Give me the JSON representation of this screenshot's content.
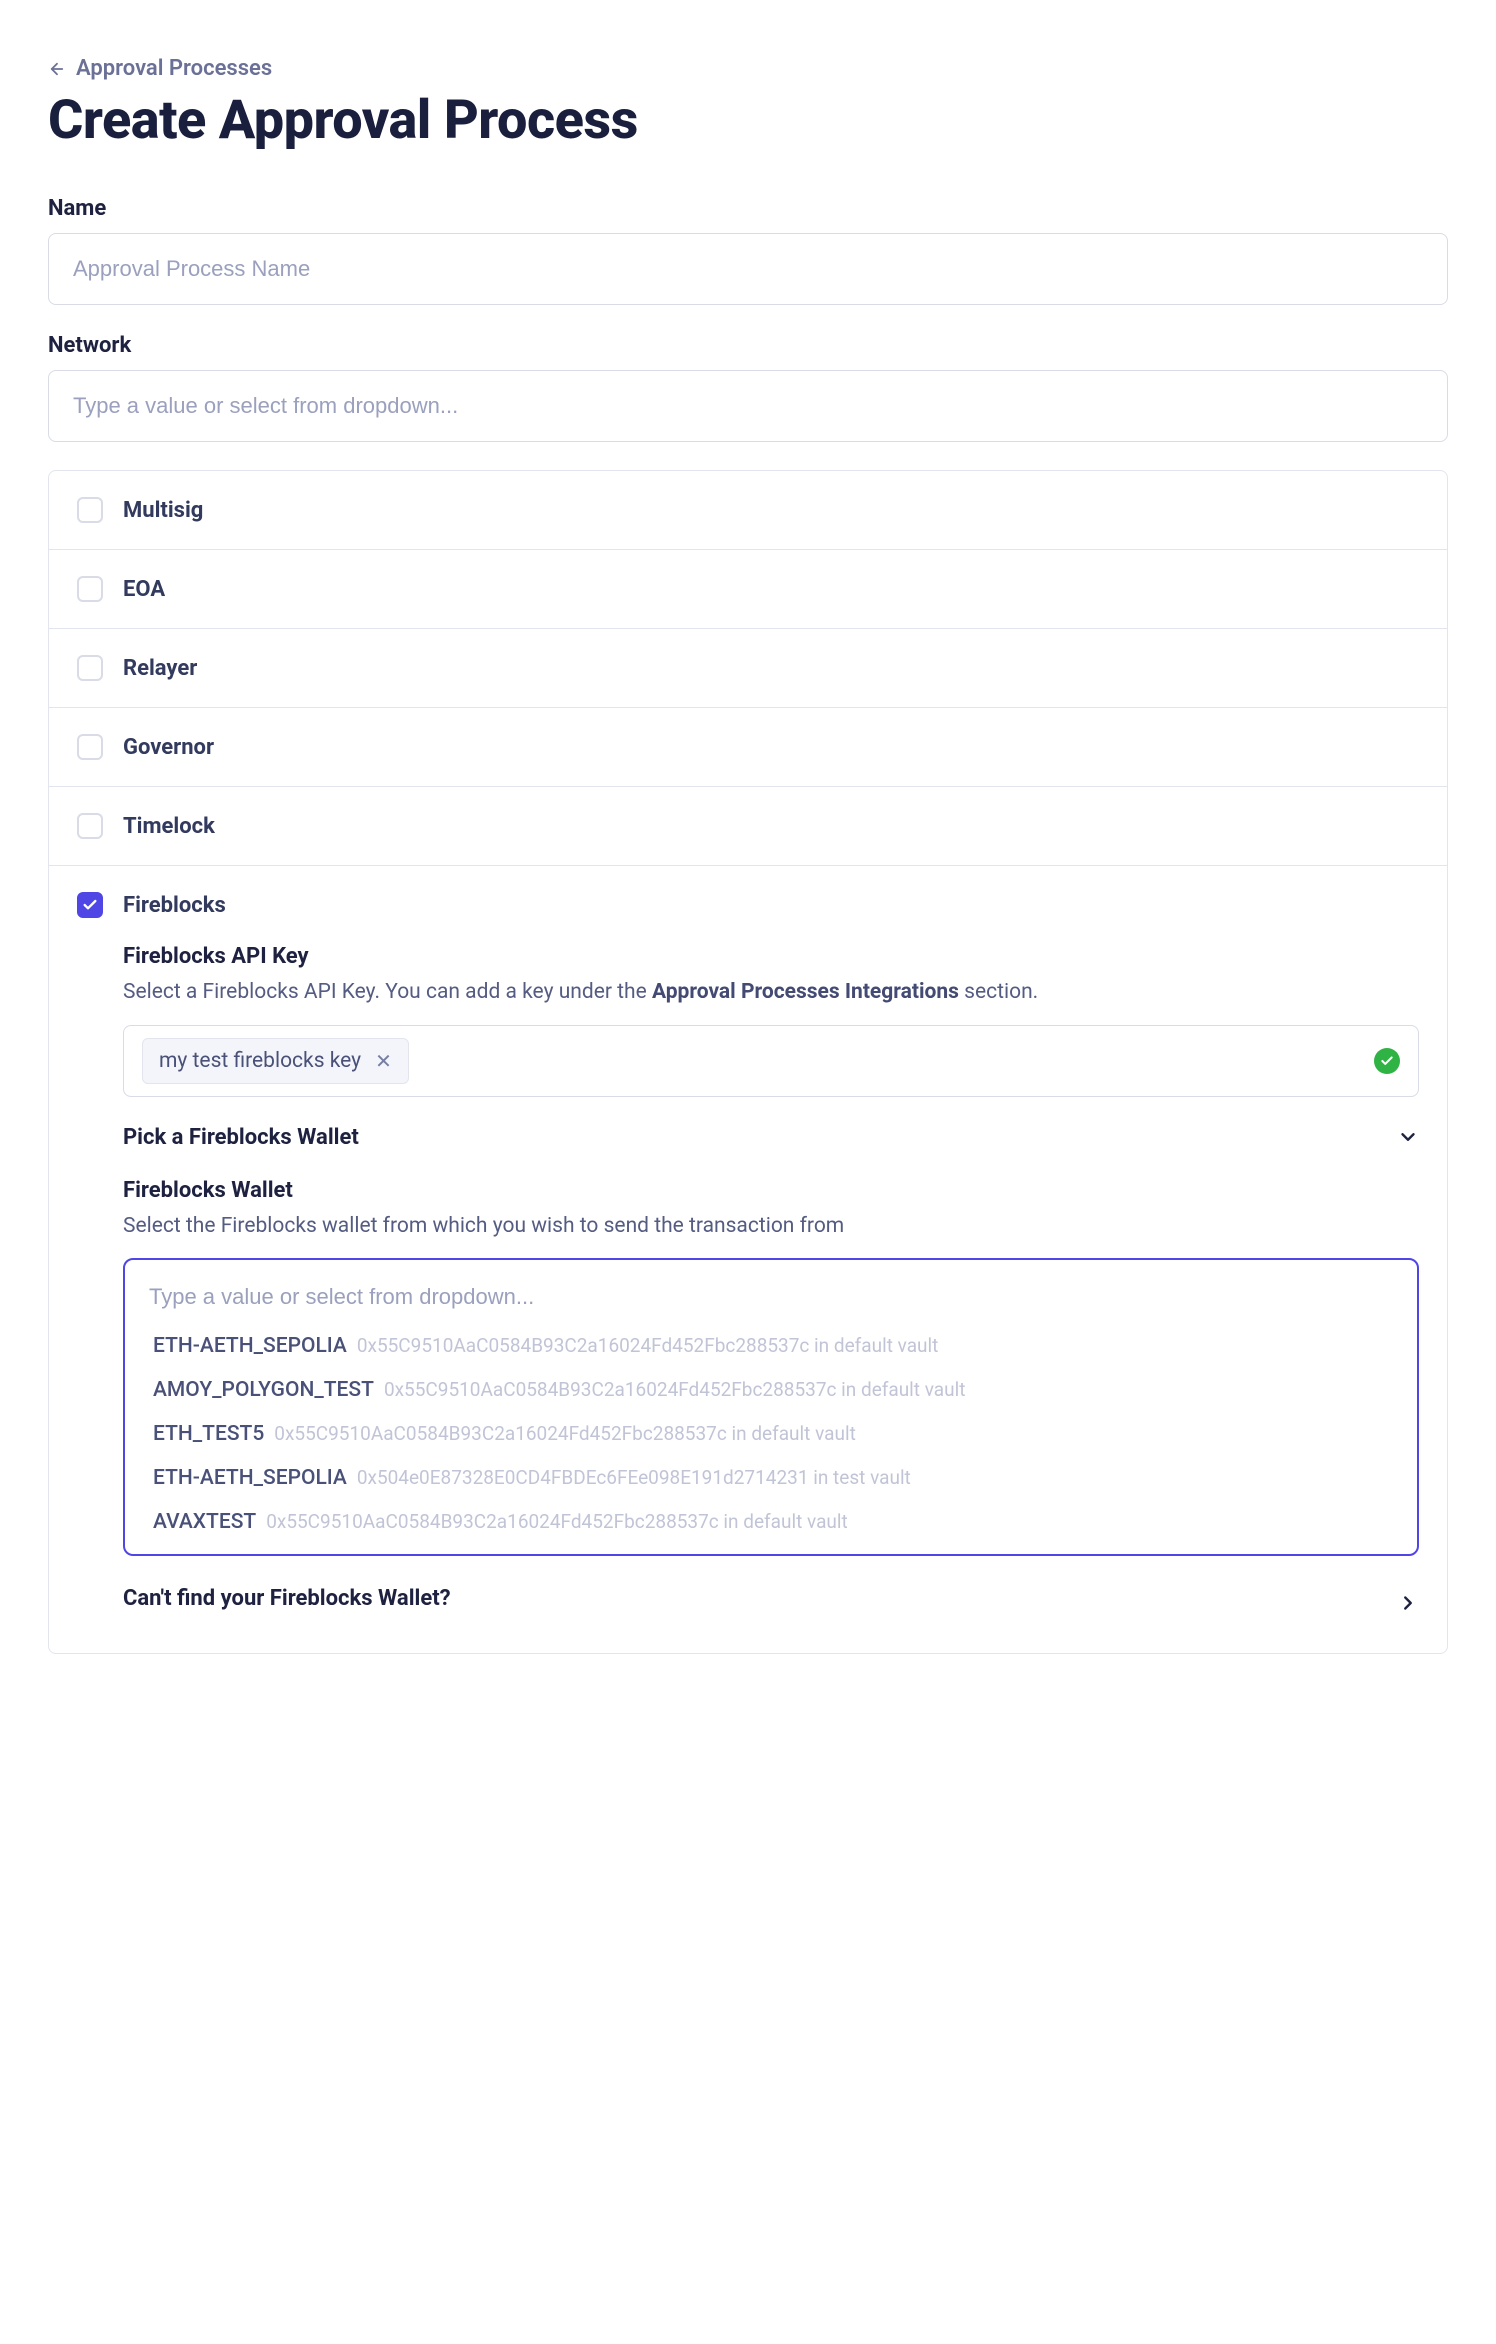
{
  "breadcrumb": {
    "back_label": "Approval Processes"
  },
  "page": {
    "title": "Create Approval Process"
  },
  "fields": {
    "name": {
      "label": "Name",
      "placeholder": "Approval Process Name"
    },
    "network": {
      "label": "Network",
      "placeholder": "Type a value or select from dropdown..."
    }
  },
  "typeOptions": {
    "multisig": {
      "label": "Multisig",
      "checked": false
    },
    "eoa": {
      "label": "EOA",
      "checked": false
    },
    "relayer": {
      "label": "Relayer",
      "checked": false
    },
    "governor": {
      "label": "Governor",
      "checked": false
    },
    "timelock": {
      "label": "Timelock",
      "checked": false
    },
    "fireblocks": {
      "label": "Fireblocks",
      "checked": true
    }
  },
  "fireblocks": {
    "apiKey": {
      "heading": "Fireblocks API Key",
      "desc_prefix": "Select a Fireblocks API Key. You can add a key under the ",
      "desc_bold": "Approval Processes Integrations",
      "desc_suffix": " section.",
      "chip_value": "my test fireblocks key"
    },
    "pickWallet": {
      "heading": "Pick a Fireblocks Wallet"
    },
    "wallet": {
      "heading": "Fireblocks Wallet",
      "desc": "Select the Fireblocks wallet from which you wish to send the transaction from",
      "placeholder": "Type a value or select from dropdown...",
      "options": [
        {
          "name": "ETH-AETH_SEPOLIA",
          "detail": "0x55C9510AaC0584B93C2a16024Fd452Fbc288537c in default vault"
        },
        {
          "name": "AMOY_POLYGON_TEST",
          "detail": "0x55C9510AaC0584B93C2a16024Fd452Fbc288537c in default vault"
        },
        {
          "name": "ETH_TEST5",
          "detail": "0x55C9510AaC0584B93C2a16024Fd452Fbc288537c in default vault"
        },
        {
          "name": "ETH-AETH_SEPOLIA",
          "detail": "0x504e0E87328E0CD4FBDEc6FEe098E191d2714231 in test vault"
        },
        {
          "name": "AVAXTEST",
          "detail": "0x55C9510AaC0584B93C2a16024Fd452Fbc288537c in default vault"
        }
      ]
    },
    "cantFind": {
      "label": "Can't find your Fireblocks Wallet?"
    }
  }
}
